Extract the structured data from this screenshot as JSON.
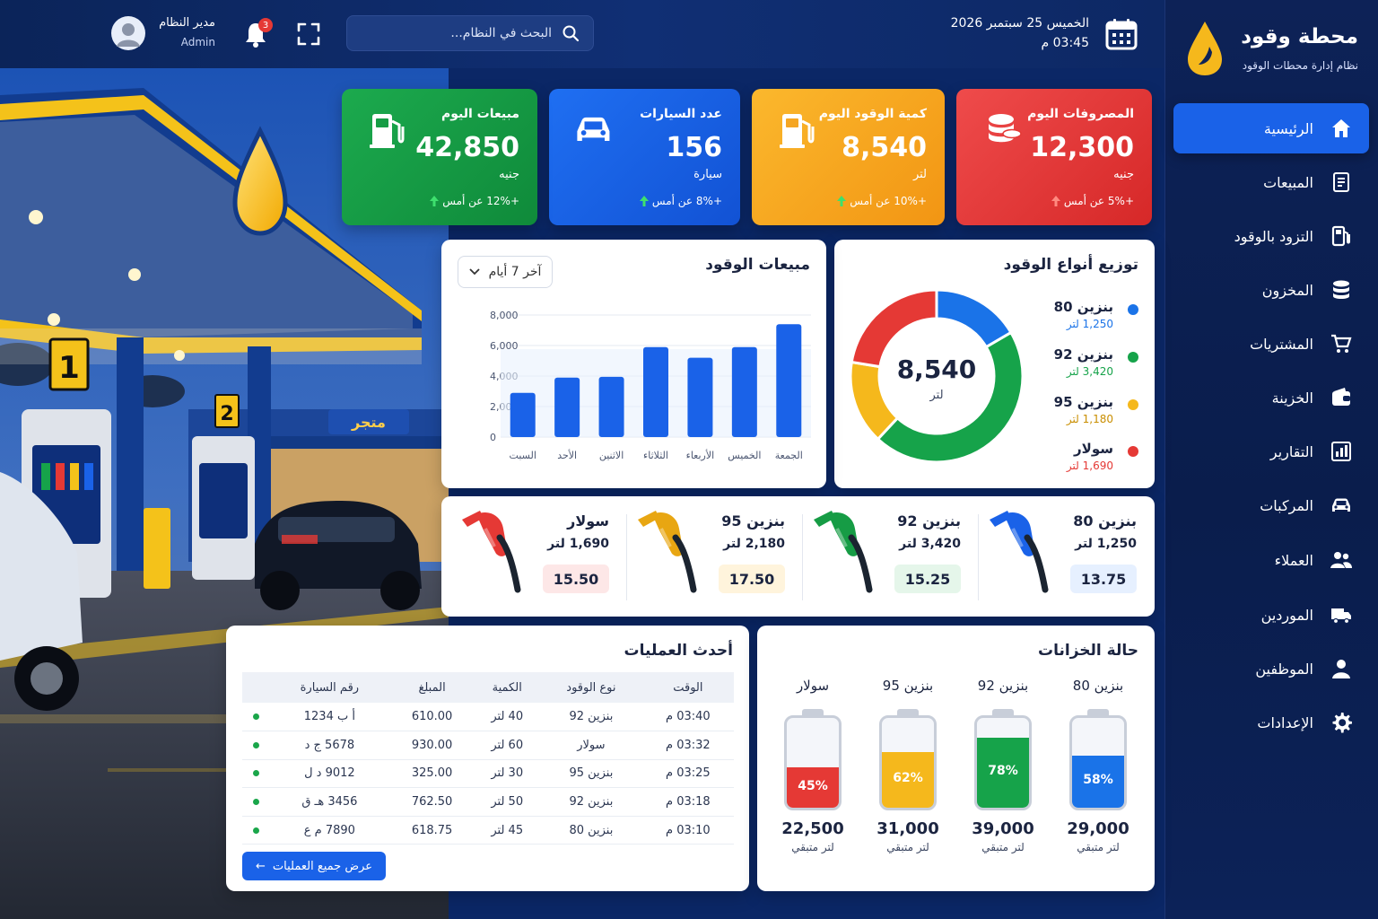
{
  "brand": {
    "title": "محطة وقود",
    "subtitle": "نظام إدارة محطات الوقود"
  },
  "header": {
    "date": "الخميس 25 سبتمبر 2026",
    "time": "03:45 م",
    "search_placeholder": "البحث في النظام...",
    "notifications": "3",
    "user_name": "مدير النظام",
    "user_role": "Admin"
  },
  "nav": [
    {
      "label": "الرئيسية",
      "icon": "home-icon",
      "active": true
    },
    {
      "label": "المبيعات",
      "icon": "receipt-icon"
    },
    {
      "label": "التزود بالوقود",
      "icon": "fuel-pump-icon"
    },
    {
      "label": "المخزون",
      "icon": "database-icon"
    },
    {
      "label": "المشتريات",
      "icon": "cart-icon"
    },
    {
      "label": "الخزينة",
      "icon": "wallet-icon"
    },
    {
      "label": "التقارير",
      "icon": "bar-chart-icon"
    },
    {
      "label": "المركبات",
      "icon": "car-icon"
    },
    {
      "label": "العملاء",
      "icon": "users-icon"
    },
    {
      "label": "الموردين",
      "icon": "truck-icon"
    },
    {
      "label": "الموظفين",
      "icon": "user-icon"
    },
    {
      "label": "الإعدادات",
      "icon": "gear-icon"
    }
  ],
  "kpis": [
    {
      "label": "المصروفات اليوم",
      "value": "12,300",
      "unit": "جنيه",
      "change": "+5% عن أمس",
      "color": "#e53935",
      "icon": "coins-icon",
      "trend": "up-red"
    },
    {
      "label": "كمية الوقود اليوم",
      "value": "8,540",
      "unit": "لتر",
      "change": "+10% عن أمس",
      "color": "#f5a623",
      "icon": "fuel-pump-icon",
      "trend": "up-green"
    },
    {
      "label": "عدد السيارات",
      "value": "156",
      "unit": "سيارة",
      "change": "+8% عن أمس",
      "color": "#1a62e8",
      "icon": "car-icon",
      "trend": "up-green"
    },
    {
      "label": "مبيعات اليوم",
      "value": "42,850",
      "unit": "جنيه",
      "change": "+12% عن أمس",
      "color": "#169c45",
      "icon": "fuel-pump-icon",
      "trend": "up-green"
    }
  ],
  "sales_panel": {
    "title": "مبيعات الوقود",
    "range": "آخر 7 أيام"
  },
  "donut_panel": {
    "title": "توزيع أنواع الوقود",
    "center_value": "8,540",
    "center_unit": "لتر",
    "legend": [
      {
        "name": "بنزين 80",
        "value": "1,250 لتر",
        "color": "#1a73e8"
      },
      {
        "name": "بنزين 92",
        "value": "3,420 لتر",
        "color": "#16a34a"
      },
      {
        "name": "بنزين 95",
        "value": "1,180 لتر",
        "color": "#f5b81c"
      },
      {
        "name": "سولار",
        "value": "1,690 لتر",
        "color": "#e53935"
      }
    ]
  },
  "chart_data": [
    {
      "type": "bar",
      "categories": [
        "السبت",
        "الأحد",
        "الاثنين",
        "الثلاثاء",
        "الأربعاء",
        "الخميس",
        "الجمعة"
      ],
      "values": [
        2900,
        3900,
        3950,
        5900,
        5200,
        5900,
        7400
      ],
      "ylim": [
        0,
        8000
      ],
      "yticks": [
        "0",
        "2,000",
        "4,000",
        "6,000",
        "8,000"
      ],
      "grid": true,
      "color": "#1a62e8"
    },
    {
      "type": "pie",
      "categories": [
        "بنزين 80",
        "بنزين 92",
        "بنزين 95",
        "سولار"
      ],
      "values": [
        1250,
        3420,
        1180,
        1690
      ],
      "colors": [
        "#1a73e8",
        "#16a34a",
        "#f5b81c",
        "#e53935"
      ]
    }
  ],
  "prices": [
    {
      "name": "بنزين 80",
      "liters": "1,250 لتر",
      "price": "13.75",
      "color": "#1a62e8",
      "bg": "#e6f0ff"
    },
    {
      "name": "بنزين 92",
      "liters": "3,420 لتر",
      "price": "15.25",
      "color": "#169c45",
      "bg": "#e5f6ea"
    },
    {
      "name": "بنزين 95",
      "liters": "2,180 لتر",
      "price": "17.50",
      "color": "#e8a612",
      "bg": "#fff4dc"
    },
    {
      "name": "سولار",
      "liters": "1,690 لتر",
      "price": "15.50",
      "color": "#e53935",
      "bg": "#fde7e7"
    }
  ],
  "transactions": {
    "title": "أحدث العمليات",
    "headers": [
      "الوقت",
      "نوع الوقود",
      "الكمية",
      "المبلغ",
      "رقم السيارة"
    ],
    "rows": [
      [
        "03:40 م",
        "بنزين 92",
        "40 لتر",
        "610.00",
        "أ ب 1234"
      ],
      [
        "03:32 م",
        "سولار",
        "60 لتر",
        "930.00",
        "5678 ج د"
      ],
      [
        "03:25 م",
        "بنزين 95",
        "30 لتر",
        "325.00",
        "9012 د ل"
      ],
      [
        "03:18 م",
        "بنزين 92",
        "50 لتر",
        "762.50",
        "3456 هـ ق"
      ],
      [
        "03:10 م",
        "بنزين 80",
        "45 لتر",
        "618.75",
        "7890 م ع"
      ]
    ],
    "view_all": "عرض جميع العمليات"
  },
  "tanks": {
    "title": "حالة الخزانات",
    "items": [
      {
        "name": "بنزين 80",
        "percent": 58,
        "percent_label": "58%",
        "liters": "29,000",
        "unit": "لتر متبقي",
        "color": "#1a73e8"
      },
      {
        "name": "بنزين 92",
        "percent": 78,
        "percent_label": "78%",
        "liters": "39,000",
        "unit": "لتر متبقي",
        "color": "#16a34a"
      },
      {
        "name": "بنزين 95",
        "percent": 62,
        "percent_label": "62%",
        "liters": "31,000",
        "unit": "لتر متبقي",
        "color": "#f5b81c"
      },
      {
        "name": "سولار",
        "percent": 45,
        "percent_label": "45%",
        "liters": "22,500",
        "unit": "لتر متبقي",
        "color": "#e53935"
      }
    ]
  },
  "photo": {
    "store_sign": "متجر",
    "pump1": "1",
    "pump2": "2"
  }
}
